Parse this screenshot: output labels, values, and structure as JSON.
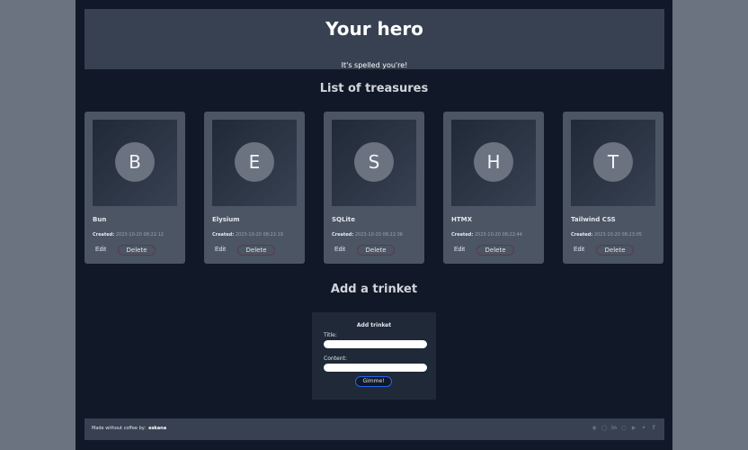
{
  "hero": {
    "title": "Your hero",
    "subtitle": "It's spelled you're!"
  },
  "treasures": {
    "heading": "List of treasures",
    "created_label": "Created:",
    "edit_label": "Edit",
    "delete_label": "Delete",
    "items": [
      {
        "initial": "B",
        "title": "Bun",
        "created": "2023-10-20 08:22:12"
      },
      {
        "initial": "E",
        "title": "Elysium",
        "created": "2023-10-20 08:22:19"
      },
      {
        "initial": "S",
        "title": "SQLite",
        "created": "2023-10-20 08:22:36"
      },
      {
        "initial": "H",
        "title": "HTMX",
        "created": "2023-10-20 08:22:44"
      },
      {
        "initial": "T",
        "title": "Tailwind CSS",
        "created": "2023-10-20 08:23:05"
      }
    ]
  },
  "add": {
    "heading": "Add a trinket",
    "form_title": "Add trinket",
    "title_label": "Title:",
    "content_label": "Content:",
    "submit_label": "Gimme!"
  },
  "footer": {
    "made_text": "Made without coffee by:",
    "author": "eskana",
    "icons": [
      "discord-icon",
      "github-icon",
      "linkedin-icon",
      "instagram-icon",
      "youtube-icon",
      "twitter-icon",
      "facebook-icon"
    ]
  }
}
